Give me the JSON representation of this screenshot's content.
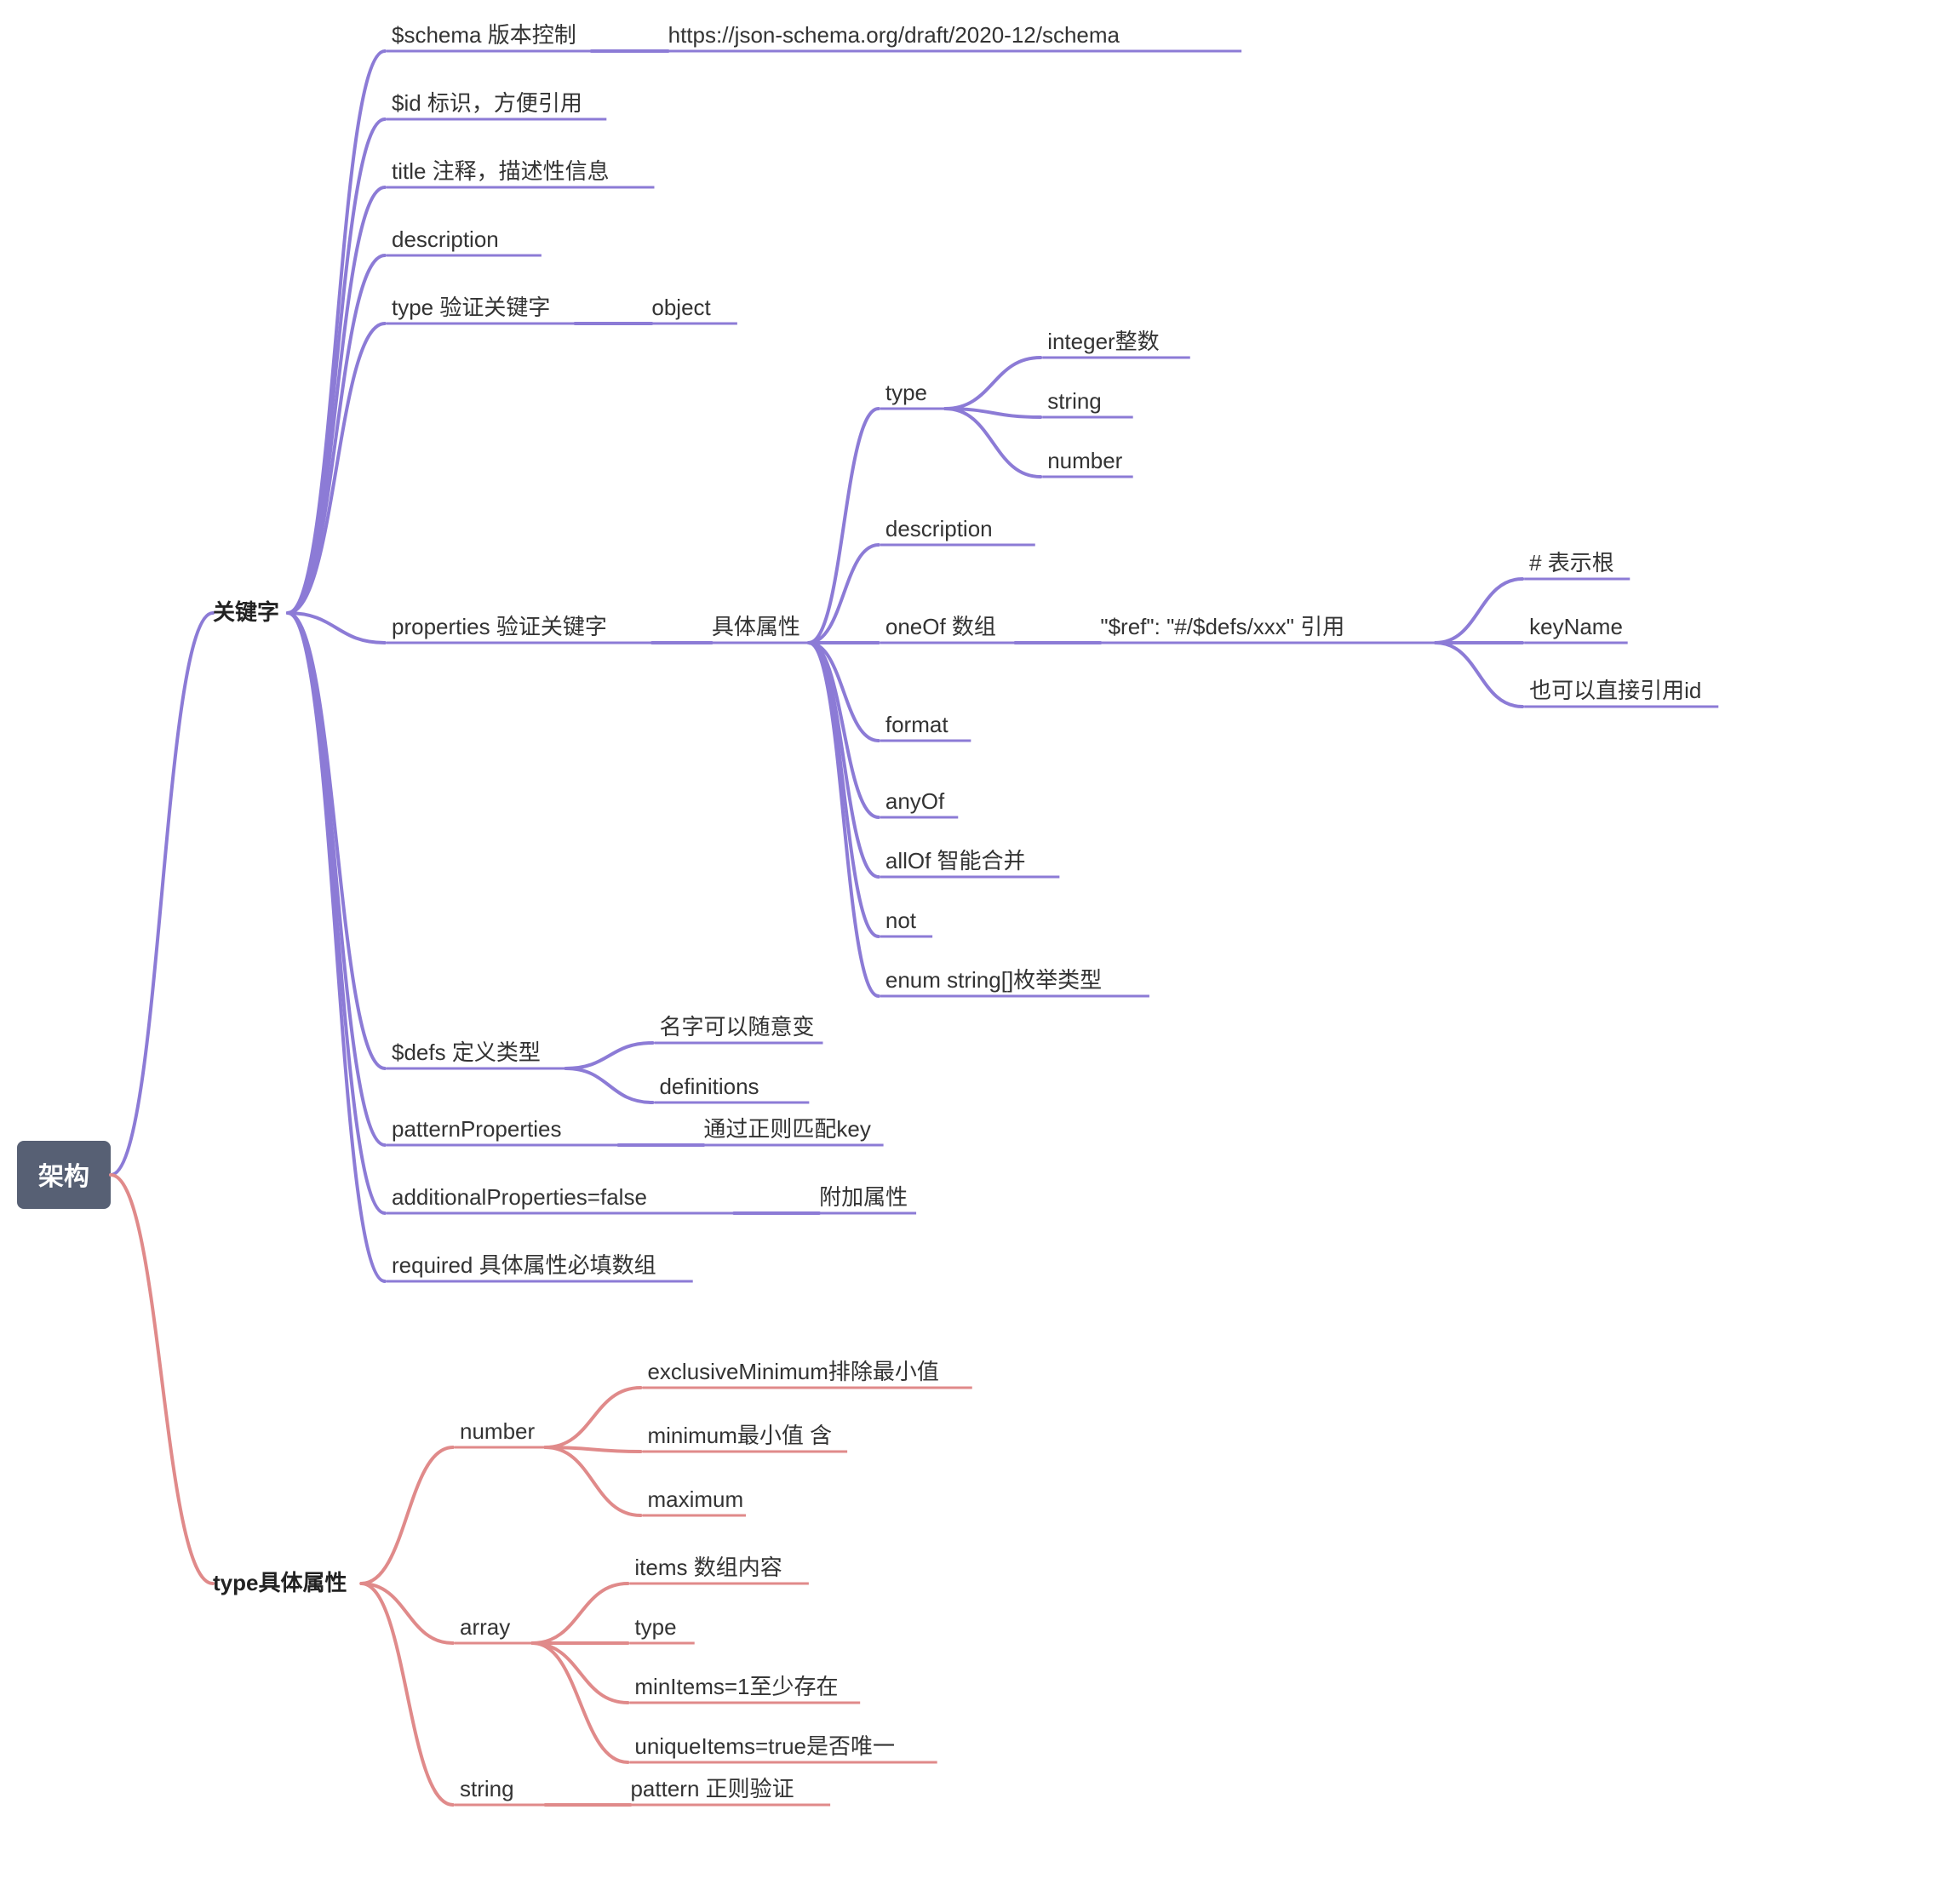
{
  "root": "架构",
  "b1": {
    "title": "关键字",
    "schema": {
      "label": "$schema 版本控制",
      "value": "https://json-schema.org/draft/2020-12/schema"
    },
    "id": "$id 标识，方便引用",
    "titleNode": "title 注释，描述性信息",
    "description": "description",
    "type": {
      "label": "type 验证关键字",
      "value": "object"
    },
    "properties": {
      "label": "properties 验证关键字",
      "detail": "具体属性",
      "type": {
        "label": "type",
        "c": [
          "integer整数",
          "string",
          "number"
        ]
      },
      "desc": "description",
      "oneOf": {
        "label": "oneOf 数组",
        "ref": {
          "label": "\"$ref\": \"#/$defs/xxx\" 引用",
          "c": [
            "# 表示根",
            "keyName",
            "也可以直接引用id"
          ]
        }
      },
      "format": "format",
      "anyOf": "anyOf",
      "allOf": "allOf 智能合并",
      "not": "not",
      "enum": "enum string[]枚举类型"
    },
    "defs": {
      "label": "$defs 定义类型",
      "c": [
        "名字可以随意变",
        "definitions"
      ]
    },
    "patternProps": {
      "label": "patternProperties",
      "value": "通过正则匹配key"
    },
    "addProps": {
      "label": "additionalProperties=false",
      "value": "附加属性"
    },
    "required": "required 具体属性必填数组"
  },
  "b2": {
    "title": "type具体属性",
    "number": {
      "label": "number",
      "c": [
        "exclusiveMinimum排除最小值",
        "minimum最小值 含",
        "maximum"
      ]
    },
    "array": {
      "label": "array",
      "c": [
        "items 数组内容",
        "type",
        "minItems=1至少存在",
        "uniqueItems=true是否唯一"
      ]
    },
    "string": {
      "label": "string",
      "value": "pattern 正则验证"
    }
  }
}
